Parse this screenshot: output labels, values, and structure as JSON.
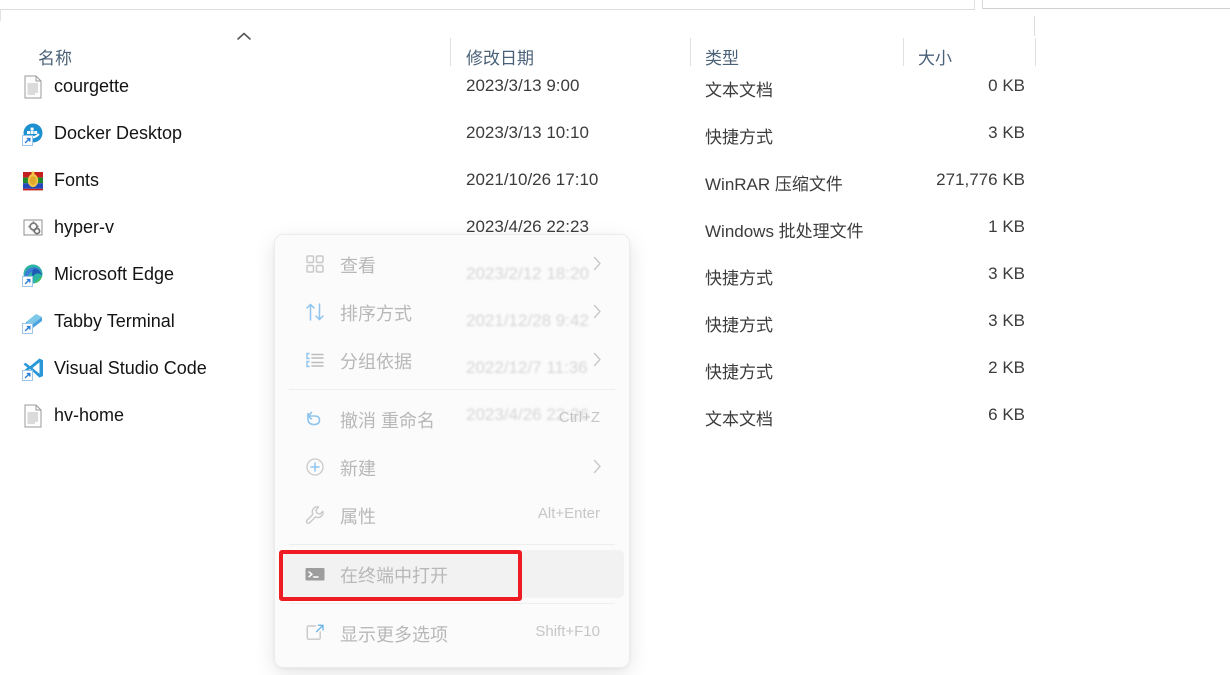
{
  "colors": {
    "header_text": "#4a6178",
    "row_text": "#141414",
    "meta_text": "#3c3c3c",
    "menu_text": "#b8b8b8",
    "accent_blue": "#60a5e8",
    "highlight_red": "#ee1c22"
  },
  "columns": {
    "name": "名称",
    "date_modified": "修改日期",
    "type": "类型",
    "size": "大小",
    "sort_indicator": "ascending-chevron"
  },
  "files": [
    {
      "name": "courgette",
      "icon": "text-document-icon",
      "date": "2023/3/13 9:00",
      "type": "文本文档",
      "size": "0 KB"
    },
    {
      "name": "Docker Desktop",
      "icon": "docker-shortcut-icon",
      "date": "2023/3/13 10:10",
      "type": "快捷方式",
      "size": "3 KB"
    },
    {
      "name": "Fonts",
      "icon": "winrar-archive-icon",
      "date": "2021/10/26 17:10",
      "type": "WinRAR 压缩文件",
      "size": "271,776 KB"
    },
    {
      "name": "hyper-v",
      "icon": "batch-file-icon",
      "date": "2023/4/26 22:23",
      "type": "Windows 批处理文件",
      "size": "1 KB"
    },
    {
      "name": "Microsoft Edge",
      "icon": "edge-shortcut-icon",
      "date": "2023/2/12 18:20",
      "type": "快捷方式",
      "size": "3 KB"
    },
    {
      "name": "Tabby Terminal",
      "icon": "tabby-shortcut-icon",
      "date": "2021/12/28 9:42",
      "type": "快捷方式",
      "size": "3 KB"
    },
    {
      "name": "Visual Studio Code",
      "icon": "vscode-shortcut-icon",
      "date": "2022/12/7 11:36",
      "type": "快捷方式",
      "size": "2 KB"
    },
    {
      "name": "hv-home",
      "icon": "text-document-icon",
      "date": "2023/4/26 22:26",
      "type": "文本文档",
      "size": "6 KB"
    }
  ],
  "context_menu": {
    "items": [
      {
        "label": "查看",
        "icon": "grid-view-icon",
        "accel": "",
        "submenu": true,
        "hovered": false,
        "divider_after": false
      },
      {
        "label": "排序方式",
        "icon": "sort-arrows-icon",
        "accel": "",
        "submenu": true,
        "hovered": false,
        "divider_after": false
      },
      {
        "label": "分组依据",
        "icon": "group-by-list-icon",
        "accel": "",
        "submenu": true,
        "hovered": false,
        "divider_after": true
      },
      {
        "label": "撤消 重命名",
        "icon": "undo-arrow-icon",
        "accel": "Ctrl+Z",
        "submenu": false,
        "hovered": false,
        "divider_after": false
      },
      {
        "label": "新建",
        "icon": "plus-circle-icon",
        "accel": "",
        "submenu": true,
        "hovered": false,
        "divider_after": false
      },
      {
        "label": "属性",
        "icon": "wrench-icon",
        "accel": "Alt+Enter",
        "submenu": false,
        "hovered": false,
        "divider_after": true
      },
      {
        "label": "在终端中打开",
        "icon": "terminal-icon",
        "accel": "",
        "submenu": false,
        "hovered": true,
        "divider_after": true
      },
      {
        "label": "显示更多选项",
        "icon": "show-more-icon",
        "accel": "Shift+F10",
        "submenu": false,
        "hovered": false,
        "divider_after": false
      }
    ]
  },
  "annotation": {
    "target_label": "在终端中打开",
    "shape": "red-rectangle-highlight"
  }
}
